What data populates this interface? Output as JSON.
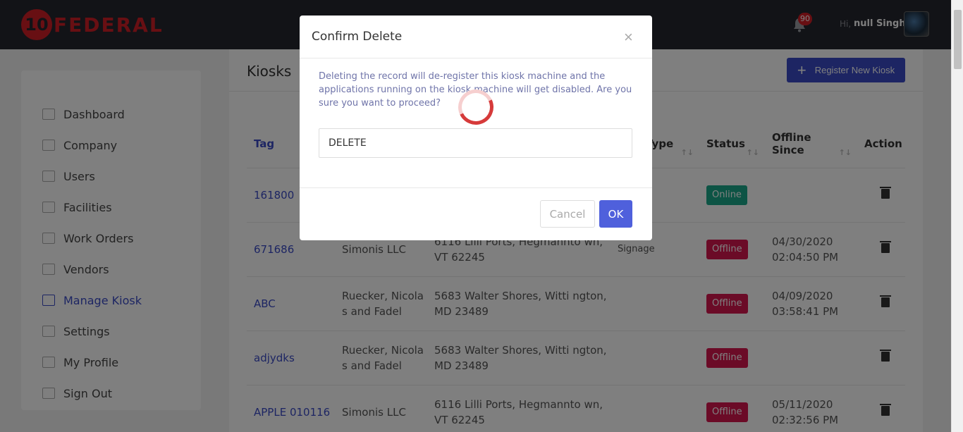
{
  "header": {
    "logo_number": "10",
    "logo_text": "FEDERAL",
    "notification_count": "90",
    "greeting": "Hi,",
    "user_name": "null Singh"
  },
  "sidebar": {
    "items": [
      {
        "label": "Dashboard",
        "icon": "dashboard-icon"
      },
      {
        "label": "Company",
        "icon": "home-icon"
      },
      {
        "label": "Users",
        "icon": "users-icon"
      },
      {
        "label": "Facilities",
        "icon": "building-icon"
      },
      {
        "label": "Work Orders",
        "icon": "clipboard-icon"
      },
      {
        "label": "Vendors",
        "icon": "cart-icon"
      },
      {
        "label": "Manage Kiosk",
        "icon": "kiosk-icon"
      },
      {
        "label": "Settings",
        "icon": "gear-icon"
      },
      {
        "label": "My Profile",
        "icon": "profile-icon"
      },
      {
        "label": "Sign Out",
        "icon": "sign-out-icon"
      }
    ],
    "active": "Manage Kiosk"
  },
  "main": {
    "title": "Kiosks",
    "register_label": "Register New Kiosk",
    "table": {
      "headers": [
        "Tag",
        "",
        "",
        "Type",
        "Status",
        "Offline Since",
        "Action"
      ],
      "rows": [
        {
          "tag": "161800",
          "company": "",
          "address": "",
          "type": "",
          "status": "Online",
          "offline_since": ""
        },
        {
          "tag": "671686",
          "company": "Simonis LLC",
          "address": "6116 Lilli Ports, Hegmannto wn, VT 62245",
          "type": "Signage",
          "status": "Offline",
          "offline_since": "04/30/2020 02:04:50 PM"
        },
        {
          "tag": "ABC",
          "company": "Ruecker, Nicola s and Fadel",
          "address": "5683 Walter Shores, Witti ngton, MD 23489",
          "type": "",
          "status": "Offline",
          "offline_since": "04/09/2020 03:58:41 PM"
        },
        {
          "tag": "adjydks",
          "company": "Ruecker, Nicola s and Fadel",
          "address": "5683 Walter Shores, Witti ngton, MD 23489",
          "type": "",
          "status": "Offline",
          "offline_since": ""
        },
        {
          "tag": "APPLE 010116",
          "company": "Simonis LLC",
          "address": "6116 Lilli Ports, Hegmannto wn, VT 62245",
          "type": "",
          "status": "Offline",
          "offline_since": "05/11/2020 02:32:56 PM"
        }
      ]
    }
  },
  "modal": {
    "title": "Confirm Delete",
    "message": "Deleting the record will de-register this kiosk machine and the applications running on the kiosk machine will get disabled. Are you sure you want to proceed?",
    "input_value": "DELETE",
    "cancel_label": "Cancel",
    "ok_label": "OK"
  },
  "colors": {
    "accent": "#3a4bc7",
    "brand_red": "#d11f26",
    "online": "#1aa98a",
    "offline": "#d7174f"
  }
}
